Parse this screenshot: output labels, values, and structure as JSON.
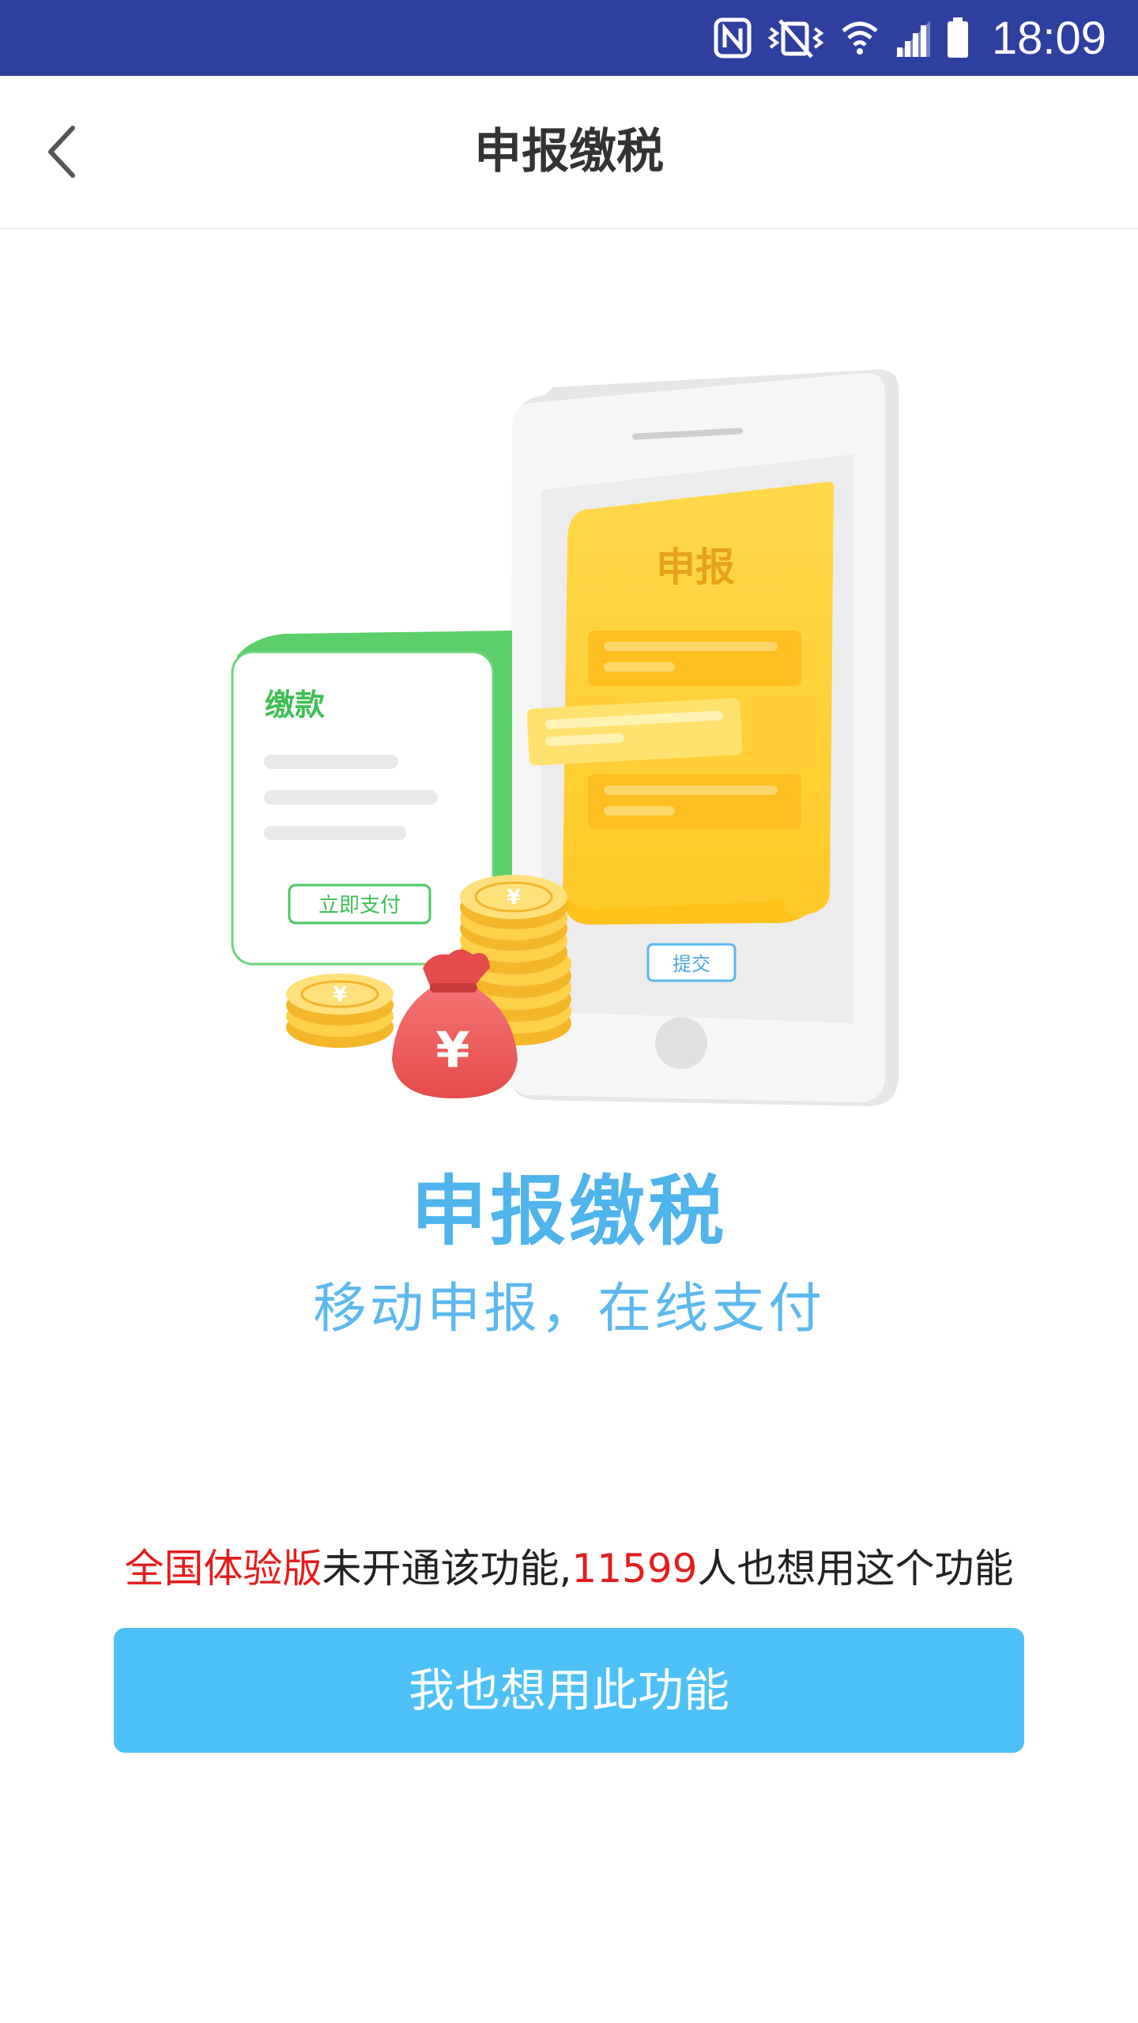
{
  "status_bar": {
    "time": "18:09",
    "background_color": "#2f3f9f",
    "icons": [
      "nfc-icon",
      "vibrate-icon",
      "wifi-icon",
      "signal-icon",
      "battery-icon"
    ]
  },
  "header": {
    "title": "申报缴税",
    "back_icon": "chevron-left-icon"
  },
  "illustration": {
    "phone_card_title": "申报",
    "payment_card_title": "缴款",
    "payment_button_label": "立即支付",
    "submit_button_label": "提交",
    "coin_symbol": "¥",
    "colors": {
      "green": "#5ccf6a",
      "yellow": "#ffd23f",
      "coin": "#ffc53a",
      "bag": "#ef5a5a"
    }
  },
  "feature": {
    "title": "申报缴税",
    "subtitle": "移动申报，在线支付"
  },
  "notice": {
    "highlight_text": "全国体验版",
    "text_middle": "未开通该功能,",
    "count": "11599",
    "text_end": "人也想用这个功能"
  },
  "cta": {
    "label": "我也想用此功能",
    "color": "#4dc1f7"
  }
}
